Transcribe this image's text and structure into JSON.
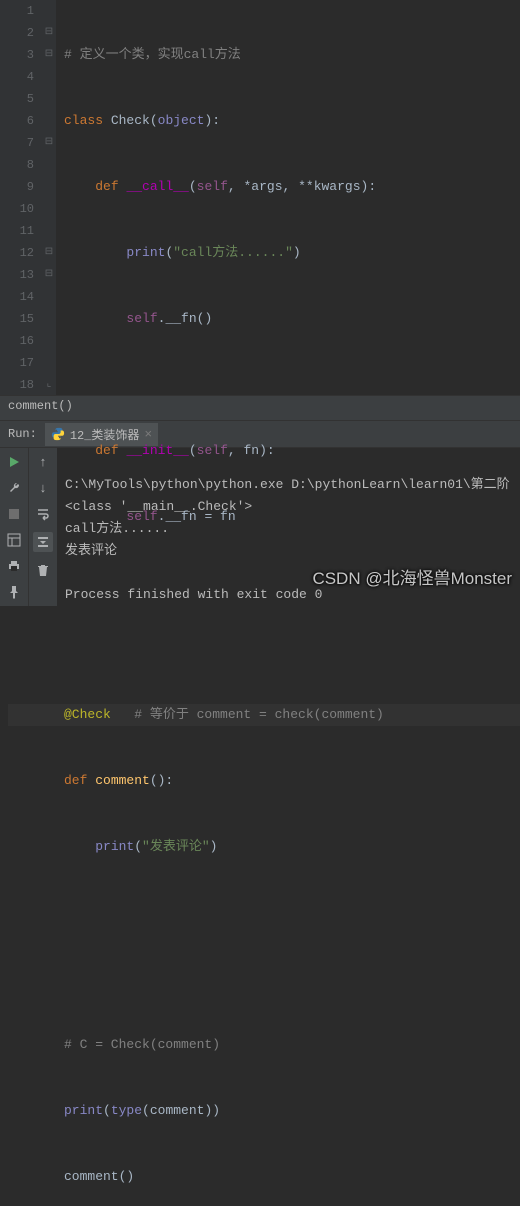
{
  "gutter": [
    "1",
    "2",
    "3",
    "4",
    "5",
    "6",
    "7",
    "8",
    "9",
    "10",
    "11",
    "12",
    "13",
    "14",
    "15",
    "16",
    "17",
    "18"
  ],
  "fold": [
    "",
    "⊟",
    "⊟",
    "",
    "",
    "",
    "⊟",
    "",
    "",
    "",
    "",
    "⊟",
    "⊟",
    "",
    "",
    "",
    "",
    "⌞"
  ],
  "code": {
    "l1": {
      "cm": "# 定义一个类，实现call方法"
    },
    "l2": {
      "kw1": "class ",
      "cls": "Check",
      "p1": "(",
      "bi": "object",
      "p2": "):"
    },
    "l3": {
      "kw1": "def ",
      "mg": "__call__",
      "p1": "(",
      "sf": "self",
      "p2": ", *args, **kwargs):"
    },
    "l4": {
      "bi": "print",
      "p1": "(",
      "st": "\"call方法......\"",
      "p2": ")"
    },
    "l5": {
      "sf": "self",
      "p1": ".__fn()"
    },
    "l7": {
      "kw1": "def ",
      "mg": "__init__",
      "p1": "(",
      "sf": "self",
      "p2": ", fn):"
    },
    "l8": {
      "sf": "self",
      "p1": ".__fn = fn"
    },
    "l11": {
      "dc": "@Check",
      "sp": "   ",
      "cm": "# 等价于 comment = check(comment)"
    },
    "l12": {
      "kw1": "def ",
      "fn": "comment",
      "p1": "():"
    },
    "l13": {
      "bi": "print",
      "p1": "(",
      "st": "\"发表评论\"",
      "p2": ")"
    },
    "l16": {
      "cm": "# C = Check(comment)"
    },
    "l17": {
      "bi1": "print",
      "p1": "(",
      "bi2": "type",
      "p2": "(comment))"
    },
    "l18": {
      "id": "comment()"
    }
  },
  "breadcrumb": "comment()",
  "run": {
    "label": "Run:",
    "tab": "12_类装饰器"
  },
  "console": {
    "l1": "C:\\MyTools\\python\\python.exe D:\\pythonLearn\\learn01\\第二阶",
    "l2": "<class '__main__.Check'>",
    "l3": "call方法......",
    "l4": "发表评论",
    "l5": "",
    "l6": "Process finished with exit code 0"
  },
  "watermark": "CSDN @北海怪兽Monster"
}
